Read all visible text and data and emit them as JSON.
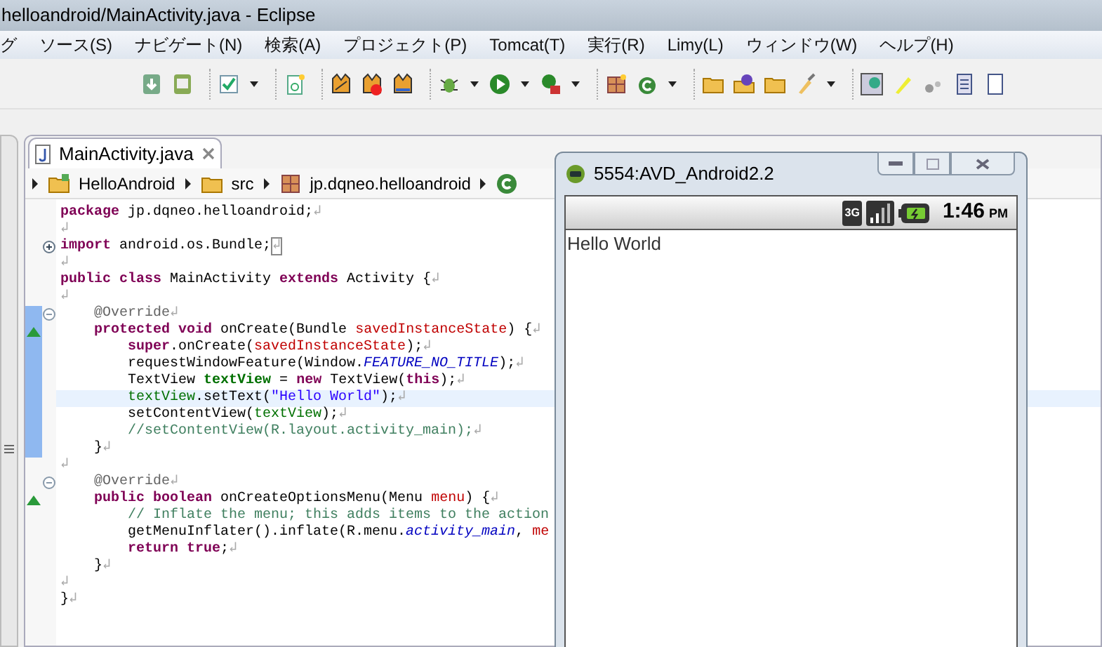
{
  "window": {
    "title": "helloandroid/MainActivity.java - Eclipse"
  },
  "menu": [
    "グ",
    "ソース(S)",
    "ナビゲート(N)",
    "検索(A)",
    "プロジェクト(P)",
    "Tomcat(T)",
    "実行(R)",
    "Limy(L)",
    "ウィンドウ(W)",
    "ヘルプ(H)"
  ],
  "editor": {
    "tab": {
      "label": "MainActivity.java",
      "selected": true
    },
    "breadcrumb": [
      "HelloAndroid",
      "src",
      "jp.dqneo.helloandroid"
    ],
    "lines": [
      {
        "changed": false,
        "current": false,
        "tokens": [
          {
            "kind": "keyword",
            "text": "package"
          },
          {
            "kind": "plain",
            "text": " jp.dqneo.helloandroid;"
          },
          {
            "kind": "eol",
            "text": "↲"
          }
        ]
      },
      {
        "changed": false,
        "current": false,
        "tokens": [
          {
            "kind": "eol",
            "text": "↲"
          }
        ]
      },
      {
        "marker": {
          "kind": "expand"
        },
        "changed": false,
        "current": false,
        "tokens": [
          {
            "kind": "keyword",
            "text": "import"
          },
          {
            "kind": "plain",
            "text": " android.os.Bundle;"
          },
          {
            "kind": "folded",
            "text": "↲"
          }
        ]
      },
      {
        "changed": false,
        "current": false,
        "tokens": [
          {
            "kind": "eol",
            "text": "↲"
          }
        ]
      },
      {
        "changed": false,
        "current": false,
        "tokens": [
          {
            "kind": "keyword",
            "text": "public class"
          },
          {
            "kind": "plain",
            "text": " MainActivity "
          },
          {
            "kind": "keyword",
            "text": "extends"
          },
          {
            "kind": "plain",
            "text": " Activity {"
          },
          {
            "kind": "eol",
            "text": "↲"
          }
        ]
      },
      {
        "changed": false,
        "current": false,
        "tokens": [
          {
            "kind": "eol",
            "text": "↲"
          }
        ]
      },
      {
        "marker": {
          "kind": "collapse"
        },
        "changed": true,
        "current": false,
        "tokens": [
          {
            "kind": "annotation",
            "text": "    @Override"
          },
          {
            "kind": "eol",
            "text": "↲"
          }
        ]
      },
      {
        "marker": {
          "kind": "override"
        },
        "changed": true,
        "current": false,
        "tokens": [
          {
            "kind": "keyword",
            "text": "    protected void"
          },
          {
            "kind": "plain",
            "text": " onCreate(Bundle "
          },
          {
            "kind": "param",
            "text": "savedInstanceState"
          },
          {
            "kind": "plain",
            "text": ") {"
          },
          {
            "kind": "eol",
            "text": "↲"
          }
        ]
      },
      {
        "changed": true,
        "current": false,
        "tokens": [
          {
            "kind": "keyword",
            "text": "        super"
          },
          {
            "kind": "plain",
            "text": ".onCreate("
          },
          {
            "kind": "param",
            "text": "savedInstanceState"
          },
          {
            "kind": "plain",
            "text": ");"
          },
          {
            "kind": "eol",
            "text": "↲"
          }
        ]
      },
      {
        "changed": true,
        "current": false,
        "tokens": [
          {
            "kind": "plain",
            "text": "        requestWindowFeature(Window."
          },
          {
            "kind": "static",
            "text": "FEATURE_NO_TITLE"
          },
          {
            "kind": "plain",
            "text": ");"
          },
          {
            "kind": "eol",
            "text": "↲"
          }
        ]
      },
      {
        "changed": true,
        "current": false,
        "tokens": [
          {
            "kind": "plain",
            "text": "        TextView "
          },
          {
            "kind": "local",
            "text": "textView"
          },
          {
            "kind": "plain",
            "text": " = "
          },
          {
            "kind": "keyword",
            "text": "new"
          },
          {
            "kind": "plain",
            "text": " TextView("
          },
          {
            "kind": "keyword",
            "text": "this"
          },
          {
            "kind": "plain",
            "text": ");"
          },
          {
            "kind": "eol",
            "text": "↲"
          }
        ]
      },
      {
        "changed": true,
        "current": true,
        "tokens": [
          {
            "kind": "variable",
            "text": "        textView"
          },
          {
            "kind": "plain",
            "text": ".setText("
          },
          {
            "kind": "string",
            "text": "\"Hello World\""
          },
          {
            "kind": "plain",
            "text": ");"
          },
          {
            "kind": "eol",
            "text": "↲"
          }
        ]
      },
      {
        "changed": true,
        "current": false,
        "tokens": [
          {
            "kind": "plain",
            "text": "        setContentView("
          },
          {
            "kind": "variable",
            "text": "textView"
          },
          {
            "kind": "plain",
            "text": ");"
          },
          {
            "kind": "eol",
            "text": "↲"
          }
        ]
      },
      {
        "changed": true,
        "current": false,
        "tokens": [
          {
            "kind": "comment",
            "text": "        //setContentView(R.layout.activity_main);"
          },
          {
            "kind": "eol",
            "text": "↲"
          }
        ]
      },
      {
        "changed": true,
        "current": false,
        "tokens": [
          {
            "kind": "plain",
            "text": "    }"
          },
          {
            "kind": "eol",
            "text": "↲"
          }
        ]
      },
      {
        "changed": false,
        "current": false,
        "tokens": [
          {
            "kind": "eol",
            "text": "↲"
          }
        ]
      },
      {
        "marker": {
          "kind": "collapse"
        },
        "changed": false,
        "current": false,
        "tokens": [
          {
            "kind": "annotation",
            "text": "    @Override"
          },
          {
            "kind": "eol",
            "text": "↲"
          }
        ]
      },
      {
        "marker": {
          "kind": "override"
        },
        "changed": false,
        "current": false,
        "tokens": [
          {
            "kind": "keyword",
            "text": "    public boolean"
          },
          {
            "kind": "plain",
            "text": " onCreateOptionsMenu(Menu "
          },
          {
            "kind": "param",
            "text": "menu"
          },
          {
            "kind": "plain",
            "text": ") {"
          },
          {
            "kind": "eol",
            "text": "↲"
          }
        ]
      },
      {
        "changed": false,
        "current": false,
        "tokens": [
          {
            "kind": "comment",
            "text": "        // Inflate the menu; this adds items to the action"
          }
        ]
      },
      {
        "changed": false,
        "current": false,
        "tokens": [
          {
            "kind": "plain",
            "text": "        getMenuInflater().inflate(R.menu."
          },
          {
            "kind": "static",
            "text": "activity_main"
          },
          {
            "kind": "plain",
            "text": ", "
          },
          {
            "kind": "param",
            "text": "me"
          }
        ]
      },
      {
        "changed": false,
        "current": false,
        "tokens": [
          {
            "kind": "keyword",
            "text": "        return true"
          },
          {
            "kind": "plain",
            "text": ";"
          },
          {
            "kind": "eol",
            "text": "↲"
          }
        ]
      },
      {
        "changed": false,
        "current": false,
        "tokens": [
          {
            "kind": "plain",
            "text": "    }"
          },
          {
            "kind": "eol",
            "text": "↲"
          }
        ]
      },
      {
        "changed": false,
        "current": false,
        "tokens": [
          {
            "kind": "eol",
            "text": "↲"
          }
        ]
      },
      {
        "changed": false,
        "current": false,
        "tokens": [
          {
            "kind": "plain",
            "text": "}"
          },
          {
            "kind": "eol",
            "text": "↲"
          }
        ]
      }
    ]
  },
  "emulator": {
    "title": "5554:AVD_Android2.2",
    "network": "3G",
    "time": "1:46",
    "ampm": "PM",
    "content": "Hello World"
  }
}
